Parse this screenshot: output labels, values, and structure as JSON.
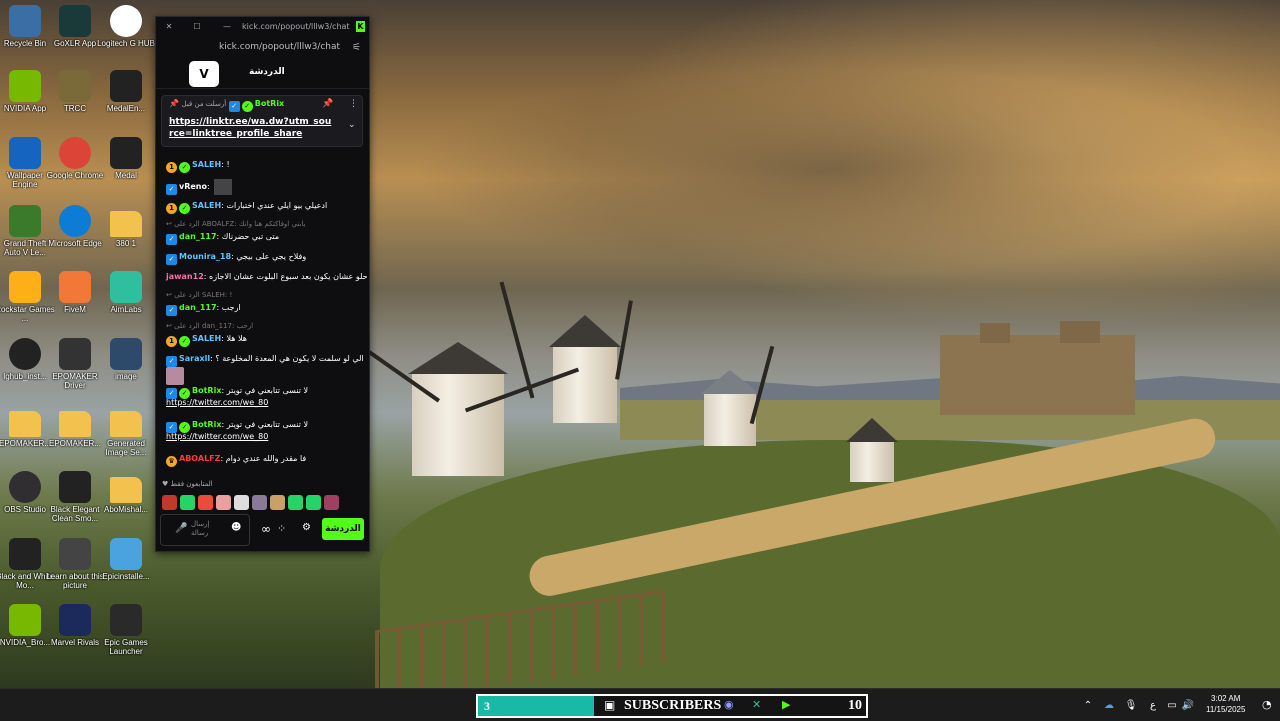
{
  "desktop_icons": [
    {
      "label": "Recycle Bin",
      "icon": "recycle-bin-icon",
      "color": "#3a6ea5"
    },
    {
      "label": "GoXLR App",
      "icon": "goxlr-icon",
      "color": "#1a3a3a"
    },
    {
      "label": "Logitech G HUB",
      "icon": "logitech-g-icon",
      "color": "#ffffff"
    },
    {
      "label": "NVIDIA App",
      "icon": "nvidia-icon",
      "color": "#76b900"
    },
    {
      "label": "TRCC",
      "icon": "trcc-icon",
      "color": "#7a6a3a"
    },
    {
      "label": "MedalEn...",
      "icon": "medal-icon",
      "color": "#222222"
    },
    {
      "label": "Wallpaper Engine",
      "icon": "wallpaper-engine-icon",
      "color": "#1565c0"
    },
    {
      "label": "Google Chrome",
      "icon": "chrome-icon",
      "color": "#db4437"
    },
    {
      "label": "Medal",
      "icon": "medal-icon",
      "color": "#222222"
    },
    {
      "label": "Grand Theft Auto V Le...",
      "icon": "gta-icon",
      "color": "#3a7a2a"
    },
    {
      "label": "Microsoft Edge",
      "icon": "edge-icon",
      "color": "#0c7cd5"
    },
    {
      "label": "380 1",
      "icon": "folder-icon",
      "color": "#f2c14e"
    },
    {
      "label": "Rockstar Games ...",
      "icon": "rockstar-icon",
      "color": "#fcaf17"
    },
    {
      "label": "FiveM",
      "icon": "fivem-icon",
      "color": "#f37736"
    },
    {
      "label": "AimLabs",
      "icon": "aimlabs-icon",
      "color": "#2fbf9f"
    },
    {
      "label": "lghub_inst...",
      "icon": "logitech-g-icon",
      "color": "#222222"
    },
    {
      "label": "EPOMAKER Driver",
      "icon": "epomaker-icon",
      "color": "#333333"
    },
    {
      "label": "image",
      "icon": "image-file-icon",
      "color": "#2d4a6a"
    },
    {
      "label": "EPOMAKER...",
      "icon": "folder-icon",
      "color": "#f2c14e"
    },
    {
      "label": "EPOMAKER...",
      "icon": "folder-icon",
      "color": "#f2c14e"
    },
    {
      "label": "Generated Image Se...",
      "icon": "folder-icon",
      "color": "#f2c14e"
    },
    {
      "label": "OBS Studio",
      "icon": "obs-icon",
      "color": "#302e31"
    },
    {
      "label": "Black Elegant Clean Smo...",
      "icon": "video-file-icon",
      "color": "#222222"
    },
    {
      "label": "AboMishal...",
      "icon": "folder-icon",
      "color": "#f2c14e"
    },
    {
      "label": "Black and White Mo...",
      "icon": "video-file-icon",
      "color": "#222222"
    },
    {
      "label": "Learn about this picture",
      "icon": "camera-icon",
      "color": "#444444"
    },
    {
      "label": "Epicinstalle...",
      "icon": "installer-icon",
      "color": "#4aa3df"
    },
    {
      "label": "NVIDIA_Bro...",
      "icon": "nvidia-icon",
      "color": "#76b900"
    },
    {
      "label": "Marvel Rivals",
      "icon": "marvel-rivals-icon",
      "color": "#1b2a5a"
    },
    {
      "label": "Epic Games Launcher",
      "icon": "epic-games-icon",
      "color": "#2a2a2a"
    }
  ],
  "chat_window": {
    "title_url": "kick.com/popout/lllw3/chat...",
    "address": "kick.com/popout/lllw3/chat",
    "header_title": "الدردشة",
    "logo_text": "V",
    "pinned": {
      "sender_label": "أرسلت من قبل",
      "sender": "BotRix",
      "link": "https://linktr.ee/wa.dw?utm_source=linktree_profile_share"
    },
    "messages": [
      {
        "user": "SALEH",
        "user_color": "#5ec4ff",
        "text": "!",
        "badges": [
          "gold",
          "green"
        ]
      },
      {
        "user": "vReno",
        "user_color": "#ffffff",
        "text": "",
        "badges": [
          "blue"
        ]
      },
      {
        "user": "SALEH",
        "user_color": "#5ec4ff",
        "text": "ادعيلي بيو ايلي عندي اختبارات",
        "badges": [
          "gold",
          "green"
        ]
      },
      {
        "reply": "الرد على ABOALFZ: يابني اوفاكتكم هنا وانك"
      },
      {
        "user": "dan_117",
        "user_color": "#53fc18",
        "text": "متى تبي حضرناك",
        "badges": [
          "blue"
        ]
      },
      {
        "user": "Mounira_18",
        "user_color": "#5ec4ff",
        "text": "وفلاح يجي على بيجي",
        "badges": [
          "blue"
        ]
      },
      {
        "user": "jawan12",
        "user_color": "#ff6fa8",
        "text": "حلو عشان يكون بعد سبوع البلوت عشان الاجازه",
        "badges": []
      },
      {
        "reply": "الرد على SALEH: !"
      },
      {
        "user": "dan_117",
        "user_color": "#53fc18",
        "text": "ارجب",
        "badges": [
          "blue"
        ]
      },
      {
        "reply": "الرد على dan_117: ارحب"
      },
      {
        "user": "SALEH",
        "user_color": "#5ec4ff",
        "text": "هلا هلا",
        "badges": [
          "gold",
          "green"
        ]
      },
      {
        "user": "Saraxll",
        "user_color": "#5ec4ff",
        "text": "الي لو سلمت لا يكون هي المعدة المخلوعة ؟",
        "badges": [
          "blue"
        ]
      },
      {
        "user": "BotRix",
        "user_color": "#53fc18",
        "text": "لا تنسى تتابعني في تويتر",
        "link": "https://twitter.com/we_80",
        "badges": [
          "blue",
          "green"
        ]
      },
      {
        "user": "BotRix",
        "user_color": "#53fc18",
        "text": "لا تنسى تتابعني في تويتر",
        "link": "https://twitter.com/we_80",
        "badges": [
          "blue",
          "green"
        ]
      },
      {
        "user": "ABOALFZ",
        "user_color": "#ff3b3b",
        "text": "فا مقدر والله عندي دوام",
        "badges": [
          "crown"
        ]
      }
    ],
    "emote_label": "المتابعون فقط",
    "input_placeholder": "إرسال رسالة",
    "send_label": "الدردشة",
    "emote_colors": [
      "#c0392b",
      "#25d366",
      "#e74c3c",
      "#e8a0a0",
      "#dddddd",
      "#8a7a9a",
      "#c8a068",
      "#25d366",
      "#25d366",
      "#a04060"
    ]
  },
  "taskbar": {
    "sub_goal": {
      "title": "SUBSCRIBERS",
      "current": "3",
      "goal": "10",
      "progress": 0.3,
      "fill_color": "#18b9a6"
    },
    "tray_lang": "ع",
    "time": "3:02 AM",
    "date": "11/15/2025"
  }
}
